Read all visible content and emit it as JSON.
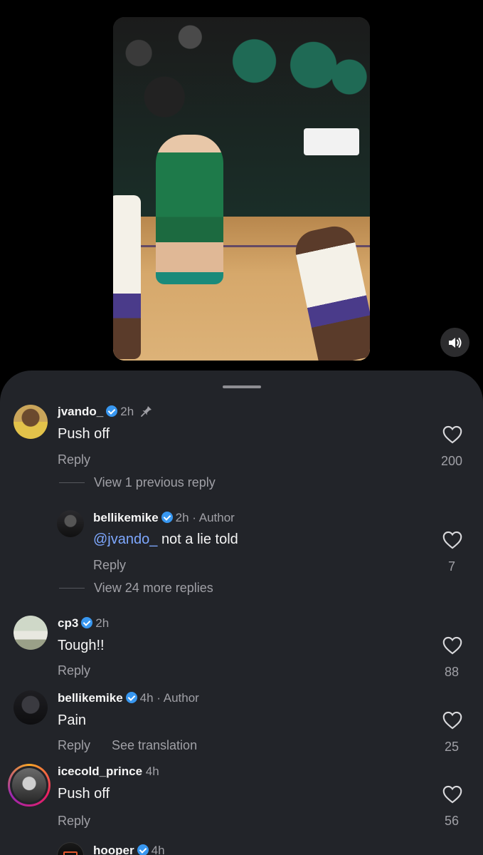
{
  "comments": [
    {
      "username": "jvando_",
      "time": "2h",
      "text": "Push off",
      "reply_label": "Reply",
      "likes": "200",
      "view_replies": "View 1 previous reply"
    },
    {
      "username": "bellikemike",
      "time": "2h · Author",
      "mention": "@jvando_",
      "text": "not a lie told",
      "reply_label": "Reply",
      "likes": "7",
      "view_replies": "View 24 more replies"
    },
    {
      "username": "cp3",
      "time": "2h",
      "text": "Tough!!",
      "reply_label": "Reply",
      "likes": "88"
    },
    {
      "username": "bellikemike",
      "time": "4h · Author",
      "text": "Pain",
      "reply_label": "Reply",
      "see_translation": "See translation",
      "likes": "25"
    },
    {
      "username": "icecold_prince",
      "time": "4h",
      "text": "Push off",
      "reply_label": "Reply",
      "likes": "56"
    },
    {
      "username": "hooper",
      "time": "4h"
    }
  ],
  "colors": {
    "sheet": "#222429",
    "verified": "#3897f0",
    "mention": "#7ea8ff",
    "secondary": "#a0a0a6"
  },
  "icons": [
    "speaker-icon",
    "pin-icon",
    "heart-icon",
    "verified-icon"
  ]
}
